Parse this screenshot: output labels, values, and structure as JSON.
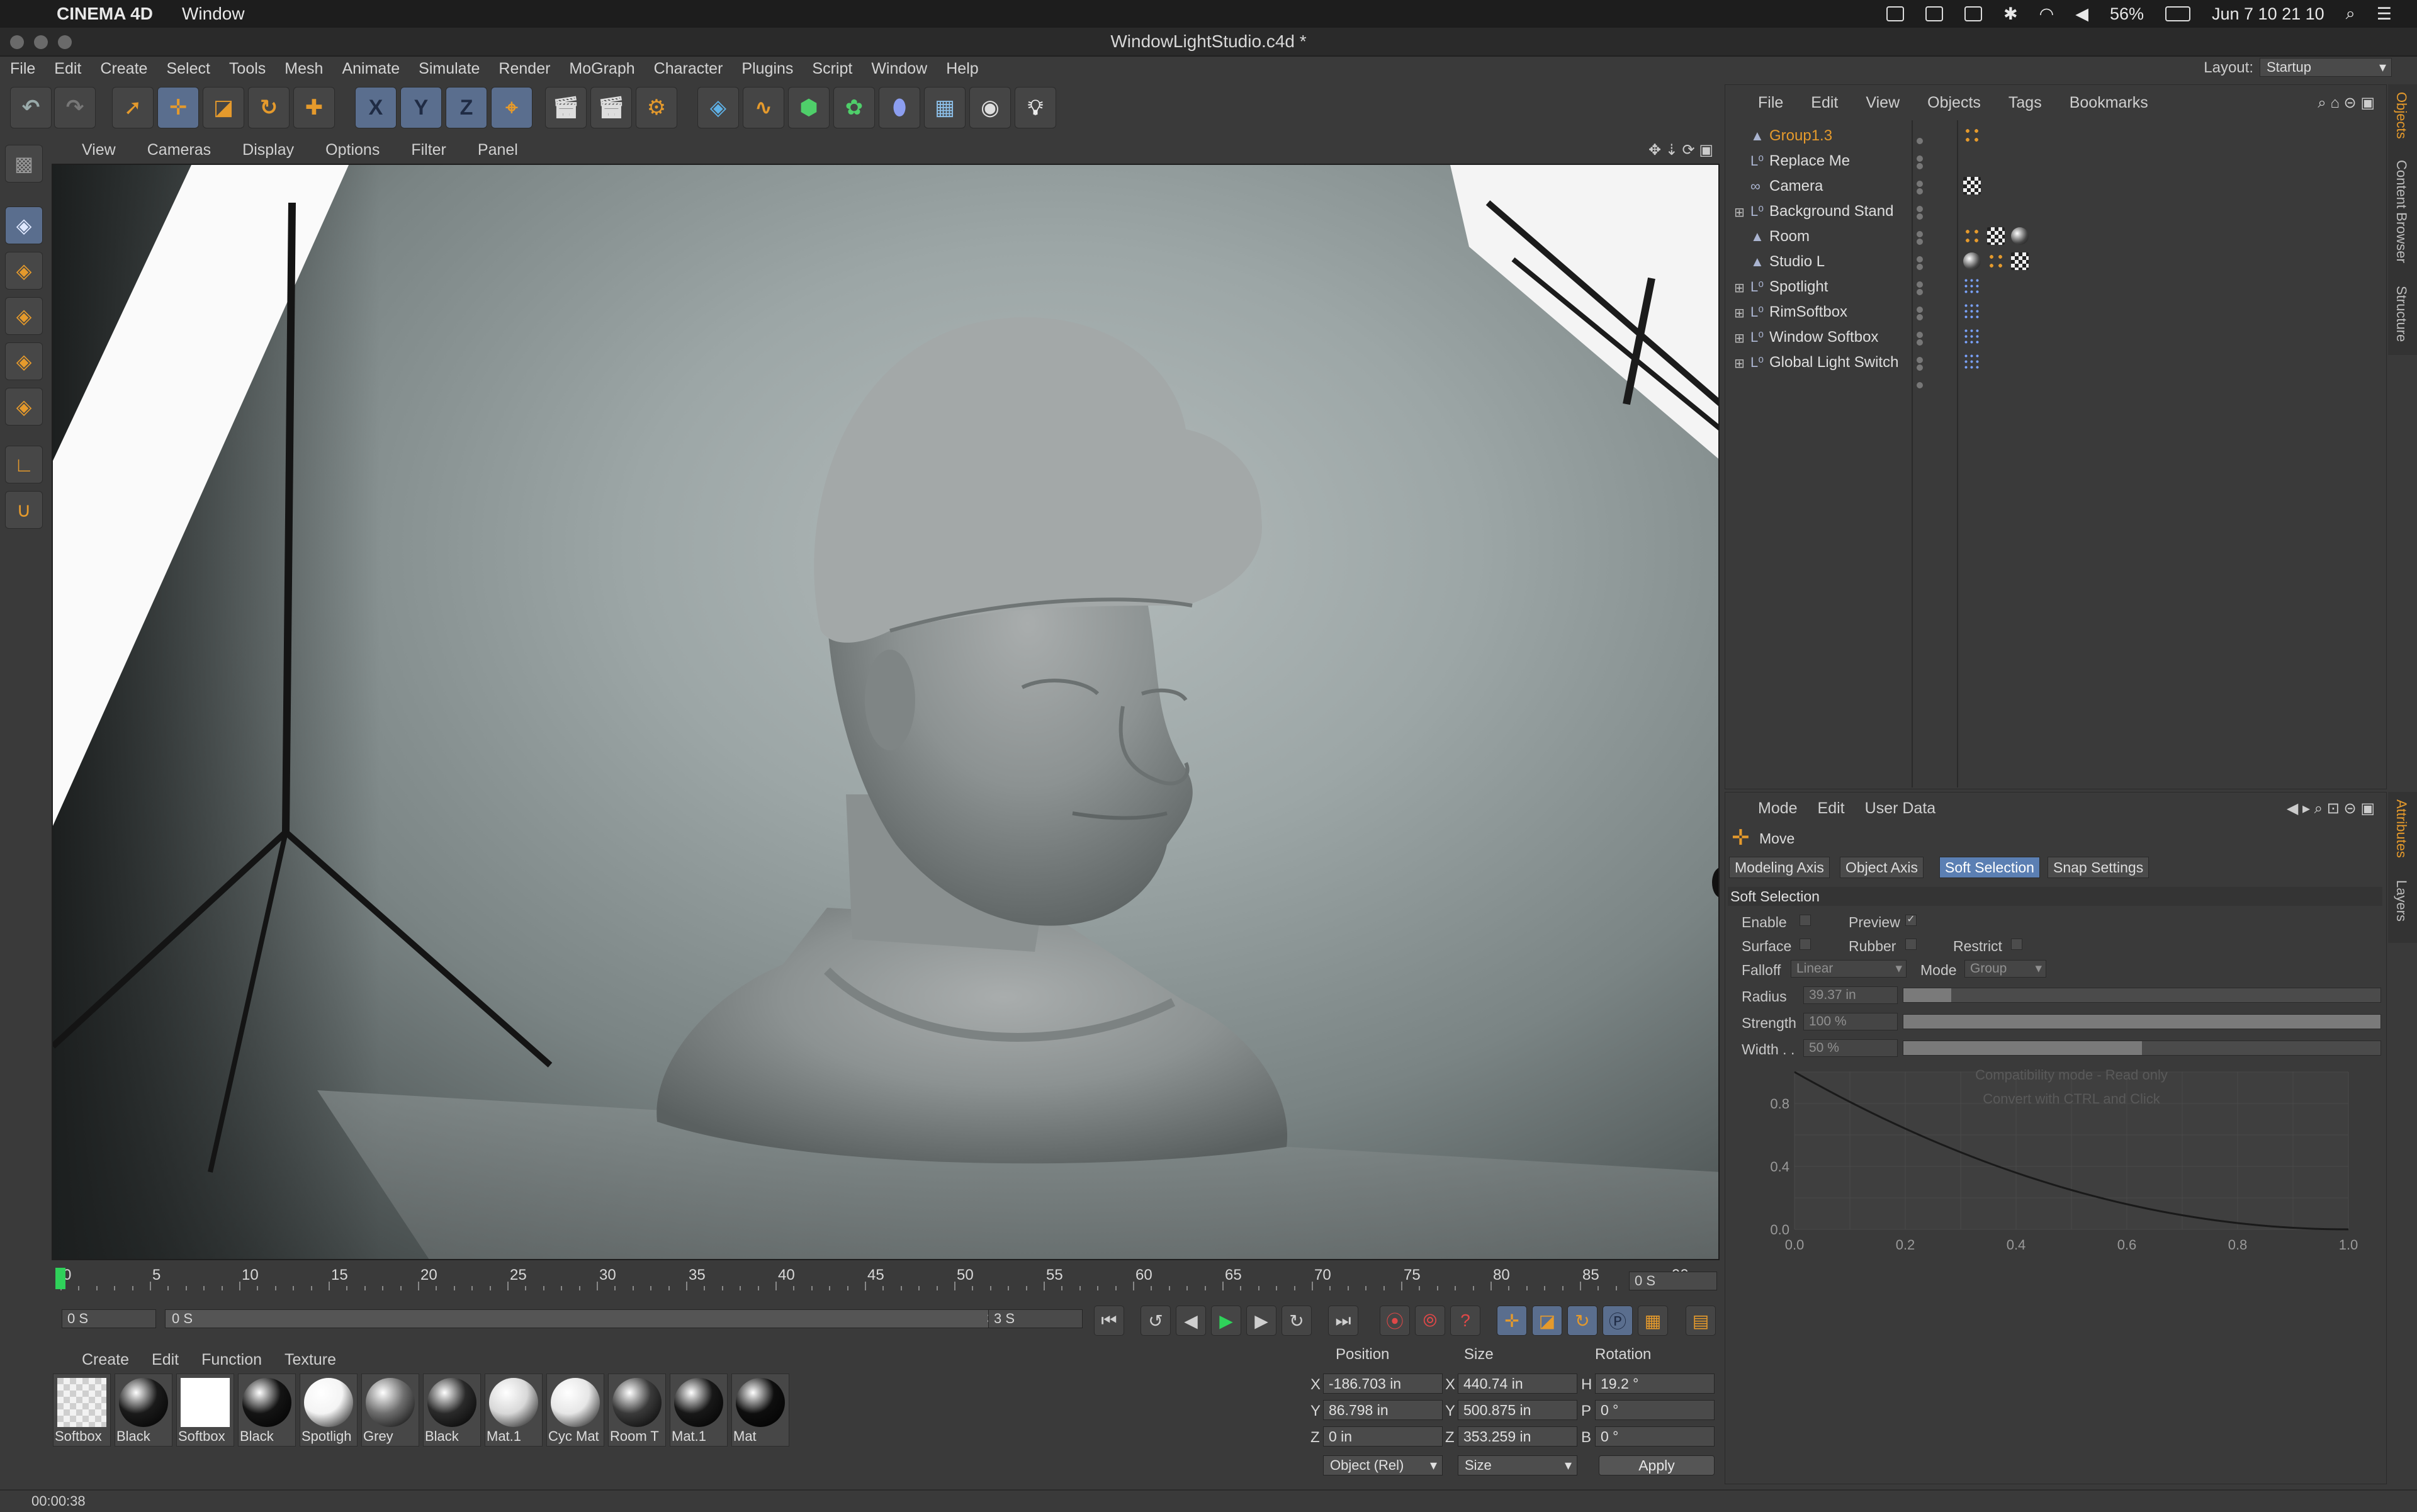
{
  "macbar": {
    "app_name": "CINEMA 4D",
    "menu_window": "Window",
    "battery": "56%",
    "datetime": "Jun 7  10 21 10"
  },
  "window": {
    "title": "WindowLightStudio.c4d *"
  },
  "app_menu": [
    "File",
    "Edit",
    "Create",
    "Select",
    "Tools",
    "Mesh",
    "Animate",
    "Simulate",
    "Render",
    "MoGraph",
    "Character",
    "Plugins",
    "Script",
    "Window",
    "Help"
  ],
  "layout": {
    "label": "Layout:",
    "value": "Startup"
  },
  "toolbar": {
    "x_label": "X",
    "y_label": "Y",
    "z_label": "Z"
  },
  "viewport_menu": [
    "View",
    "Cameras",
    "Display",
    "Options",
    "Filter",
    "Panel"
  ],
  "objects_menu": [
    "File",
    "Edit",
    "View",
    "Objects",
    "Tags",
    "Bookmarks"
  ],
  "objects": [
    {
      "name": "Group1.3",
      "type": "null",
      "selected": true,
      "expandable": false
    },
    {
      "name": "Replace Me",
      "type": "lo",
      "selected": false,
      "expandable": false
    },
    {
      "name": "Camera",
      "type": "camera",
      "selected": false,
      "expandable": false
    },
    {
      "name": "Background Stand",
      "type": "lo",
      "selected": false,
      "expandable": true
    },
    {
      "name": "Room",
      "type": "null",
      "selected": false,
      "expandable": false
    },
    {
      "name": "Studio L",
      "type": "null",
      "selected": false,
      "expandable": false
    },
    {
      "name": "Spotlight",
      "type": "lo",
      "selected": false,
      "expandable": true
    },
    {
      "name": "RimSoftbox",
      "type": "lo",
      "selected": false,
      "expandable": true
    },
    {
      "name": "Window Softbox",
      "type": "lo",
      "selected": false,
      "expandable": true
    },
    {
      "name": "Global Light Switch",
      "type": "lo",
      "selected": false,
      "expandable": true
    }
  ],
  "attributes": {
    "menu": [
      "Mode",
      "Edit",
      "User Data"
    ],
    "tool_name": "Move",
    "tabs": [
      "Modeling Axis",
      "Object Axis",
      "Soft Selection",
      "Snap Settings"
    ],
    "active_tab": "Soft Selection",
    "section": "Soft Selection",
    "enable_label": "Enable",
    "preview_label": "Preview",
    "preview_check": "✓",
    "surface_label": "Surface",
    "rubber_label": "Rubber",
    "restrict_label": "Restrict",
    "falloff_label": "Falloff",
    "falloff_value": "Linear",
    "mode_label": "Mode",
    "mode_value": "Group",
    "radius_label": "Radius",
    "radius_value": "39.37 in",
    "radius_fraction": 0.1,
    "strength_label": "Strength",
    "strength_value": "100 %",
    "strength_fraction": 1.0,
    "width_label": "Width . .",
    "width_value": "50 %",
    "width_fraction": 0.5,
    "compat_line1": "Compatibility mode - Read only",
    "compat_line2": "Convert with CTRL and Click",
    "graph_y_ticks": [
      "0.8",
      "0.4",
      "0.0"
    ],
    "graph_x_ticks": [
      "0.0",
      "0.2",
      "0.4",
      "0.6",
      "0.8",
      "1.0"
    ],
    "curve": {
      "x": [
        0,
        0.2,
        0.4,
        0.6,
        0.8,
        1.0
      ],
      "y": [
        1.0,
        0.64,
        0.36,
        0.16,
        0.04,
        0.0
      ]
    }
  },
  "side_tabs_top": [
    "Objects",
    "Content Browser",
    "Structure"
  ],
  "side_tabs_bottom": [
    "Attributes",
    "Layers"
  ],
  "timeline": {
    "ticks": [
      "0",
      "5",
      "10",
      "15",
      "20",
      "25",
      "30",
      "35",
      "40",
      "45",
      "50",
      "55",
      "60",
      "65",
      "70",
      "75",
      "80",
      "85",
      "90"
    ],
    "current_frame": "0 S"
  },
  "transport": {
    "start": "0 S",
    "range_start": "0 S",
    "range_end": "3 S",
    "end": "3 S"
  },
  "materials_menu": [
    "Create",
    "Edit",
    "Function",
    "Texture"
  ],
  "materials": [
    {
      "name": "Softbox",
      "swatch": "checker"
    },
    {
      "name": "Black",
      "swatch": "#1a1a1a"
    },
    {
      "name": "Softbox",
      "swatch": "#ffffff"
    },
    {
      "name": "Black",
      "swatch": "#141414"
    },
    {
      "name": "Spotligh",
      "swatch": "#f4f4f4"
    },
    {
      "name": "Grey",
      "swatch": "#6e6e6e"
    },
    {
      "name": "Black",
      "swatch": "#2a2a2a"
    },
    {
      "name": "Mat.1",
      "swatch": "#d8d8d8"
    },
    {
      "name": "Cyc Mat",
      "swatch": "#e6e6e6"
    },
    {
      "name": "Room T",
      "swatch": "#3a3a3a"
    },
    {
      "name": "Mat.1",
      "swatch": "#181818"
    },
    {
      "name": "Mat",
      "swatch": "#0e0e0e"
    }
  ],
  "coordinates": {
    "header_position": "Position",
    "header_size": "Size",
    "header_rotation": "Rotation",
    "px": "-186.703 in",
    "py": "86.798 in",
    "pz": "0 in",
    "sx": "440.74 in",
    "sy": "500.875 in",
    "sz": "353.259 in",
    "rh": "19.2 °",
    "rp": "0 °",
    "rb": "0 °",
    "mode_value": "Object (Rel)",
    "size_mode": "Size",
    "apply_label": "Apply",
    "axis_x": "X",
    "axis_y": "Y",
    "axis_z": "Z",
    "axis_h": "H",
    "axis_p": "P",
    "axis_b": "B"
  },
  "status": {
    "text": "00:00:38"
  },
  "colors": {
    "accent": "#e59a2c",
    "selection": "#5b7fb3",
    "panel": "#3a3a3a"
  }
}
